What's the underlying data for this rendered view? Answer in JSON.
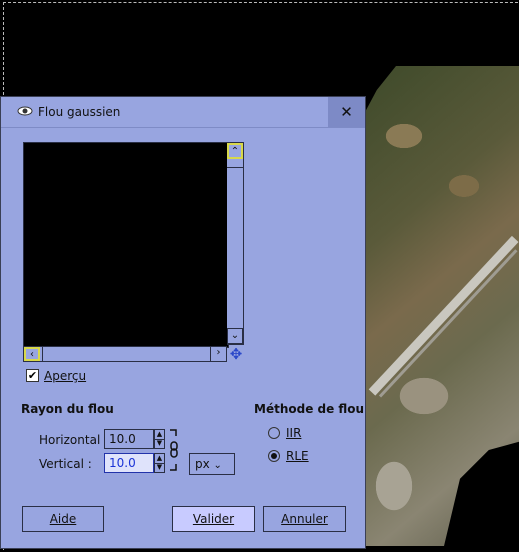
{
  "dialog": {
    "title": "Flou gaussien",
    "close_label": "✕"
  },
  "preview": {
    "checkbox_label": "Aperçu",
    "checked": true
  },
  "blur_radius": {
    "section_title": "Rayon du flou",
    "horizontal_label": "Horizontal :",
    "horizontal_value": "10.0",
    "vertical_label": "Vertical :",
    "vertical_value": "10.0",
    "unit": "px"
  },
  "blur_method": {
    "section_title": "Méthode de flou",
    "options": [
      {
        "label": "IIR",
        "selected": false
      },
      {
        "label": "RLE",
        "selected": true
      }
    ]
  },
  "buttons": {
    "help": "Aide",
    "ok": "Valider",
    "cancel": "Annuler"
  },
  "colors": {
    "dialog_bg": "#98a5e0",
    "canvas_bg": "#000000"
  }
}
